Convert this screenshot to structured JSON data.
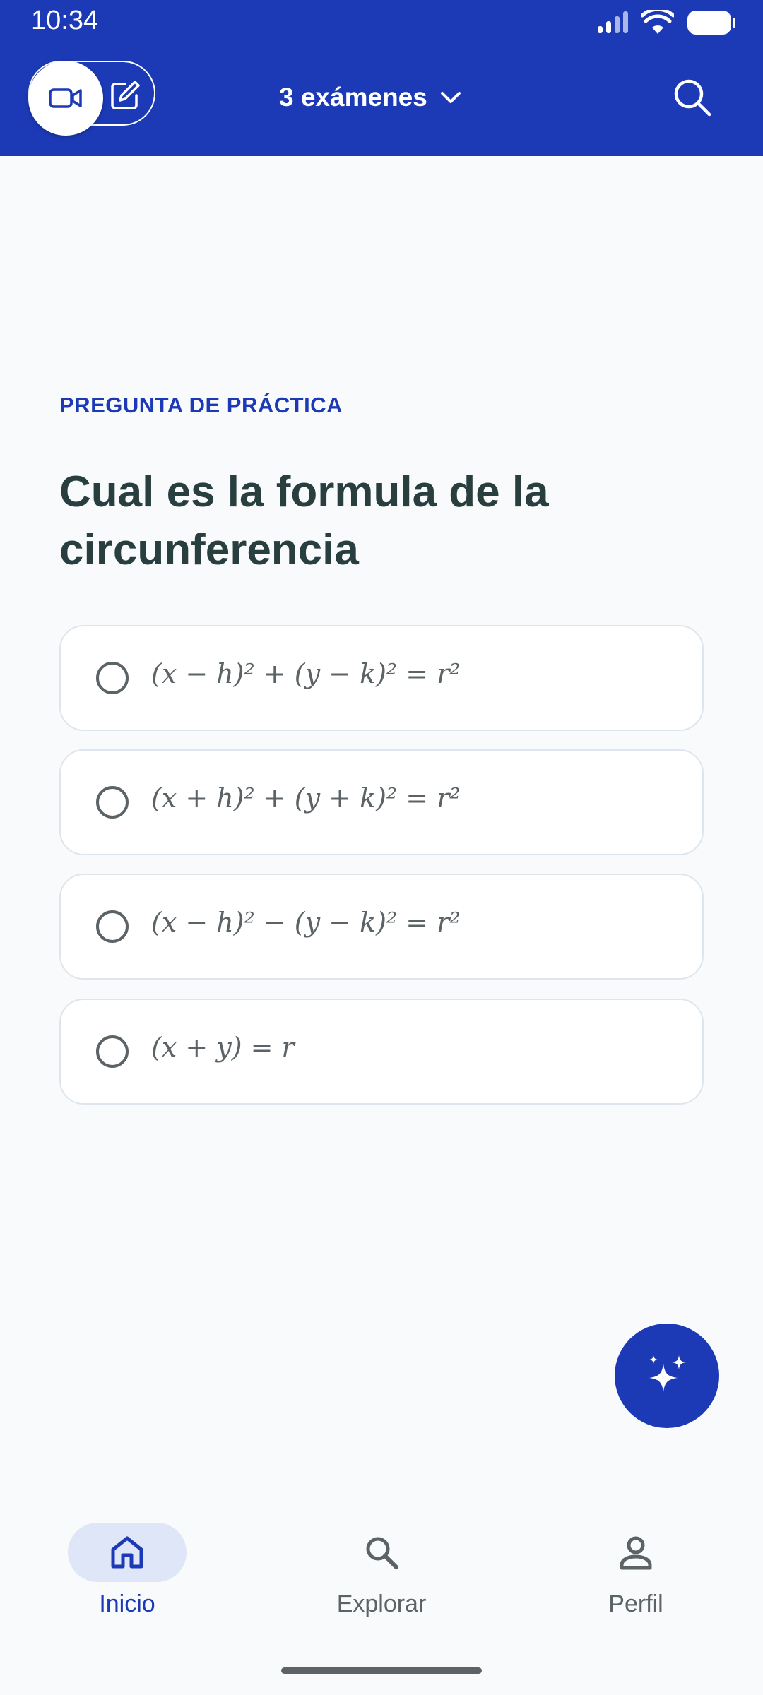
{
  "status_bar": {
    "time": "10:34"
  },
  "header": {
    "exam_selector": "3 exámenes",
    "icons": {
      "video": "video-icon",
      "edit": "edit-icon",
      "search": "search-icon",
      "dropdown": "chevron-down-icon"
    }
  },
  "question": {
    "kicker": "PREGUNTA DE PRÁCTICA",
    "text": "Cual es la formula de la circunferencia",
    "options": [
      {
        "formula": "(x − h)² + (y − k)² = r²"
      },
      {
        "formula": "(x + h)² + (y + k)² = r²"
      },
      {
        "formula": "(x − h)² − (y − k)² = r²"
      },
      {
        "formula": "(x + y) = r"
      }
    ]
  },
  "fab": {
    "icon": "sparkles-icon"
  },
  "bottom_nav": {
    "items": [
      {
        "label": "Inicio",
        "icon": "home-icon",
        "active": true
      },
      {
        "label": "Explorar",
        "icon": "search-icon",
        "active": false
      },
      {
        "label": "Perfil",
        "icon": "person-icon",
        "active": false
      }
    ]
  },
  "colors": {
    "primary": "#1c3ab5",
    "background": "#f8fafc",
    "text_dark": "#283e3f",
    "text_muted": "#5b6366"
  }
}
